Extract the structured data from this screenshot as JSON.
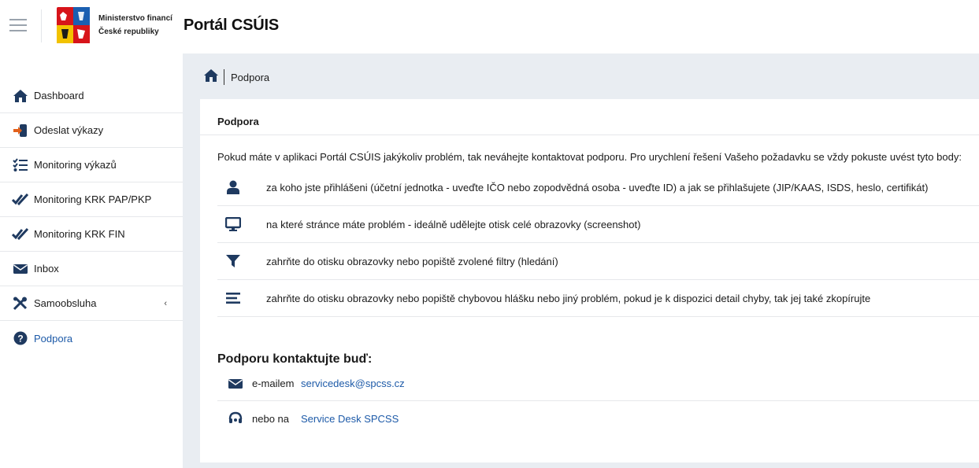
{
  "header": {
    "ministry_line1": "Ministerstvo financí",
    "ministry_line2": "České republiky",
    "portal_title": "Portál CSÚIS"
  },
  "sidebar": {
    "items": [
      {
        "label": "Dashboard",
        "icon": "home-icon"
      },
      {
        "label": "Odeslat výkazy",
        "icon": "sign-in-icon"
      },
      {
        "label": "Monitoring výkazů",
        "icon": "list-check-icon"
      },
      {
        "label": "Monitoring KRK PAP/PKP",
        "icon": "double-check-icon"
      },
      {
        "label": "Monitoring KRK FIN",
        "icon": "double-check-icon"
      },
      {
        "label": "Inbox",
        "icon": "envelope-icon"
      },
      {
        "label": "Samoobsluha",
        "icon": "tools-icon",
        "chevron": "‹"
      },
      {
        "label": "Podpora",
        "icon": "question-circle-icon",
        "active": true
      }
    ]
  },
  "breadcrumb": {
    "current": "Podpora"
  },
  "card": {
    "title": "Podpora",
    "intro": "Pokud máte v aplikaci Portál CSÚIS jakýkoliv problém, tak neváhejte kontaktovat podporu. Pro urychlení řešení Vašeho požadavku se vždy pokuste uvést tyto body:",
    "bullets": [
      {
        "icon": "user-icon",
        "text": "za koho jste přihlášeni (účetní jednotka - uveďte IČO nebo zopodvědná osoba - uveďte ID) a jak se přihlašujete (JIP/KAAS, ISDS, heslo, certifikát)"
      },
      {
        "icon": "monitor-icon",
        "text": "na které stránce máte problém - ideálně udělejte otisk celé obrazovky (screenshot)"
      },
      {
        "icon": "filter-icon",
        "text": "zahrňte do otisku obrazovky nebo popiště zvolené filtry (hledání)"
      },
      {
        "icon": "lines-icon",
        "text": "zahrňte do otisku obrazovky nebo popiště chybovou hlášku nebo jiný problém, pokud je k dispozici detail chyby, tak jej také zkopírujte"
      }
    ],
    "contact_heading": "Podporu kontaktujte buď:",
    "contacts": [
      {
        "icon": "envelope-icon",
        "label": "e-mailem",
        "link": "servicedesk@spcss.cz"
      },
      {
        "icon": "headset-icon",
        "label": "nebo na",
        "link": "Service Desk SPCSS"
      }
    ]
  },
  "colors": {
    "brand_dark": "#1f3a60",
    "link": "#1d5aa8",
    "main_bg": "#e9edf2",
    "divider": "#e6e8eb"
  }
}
